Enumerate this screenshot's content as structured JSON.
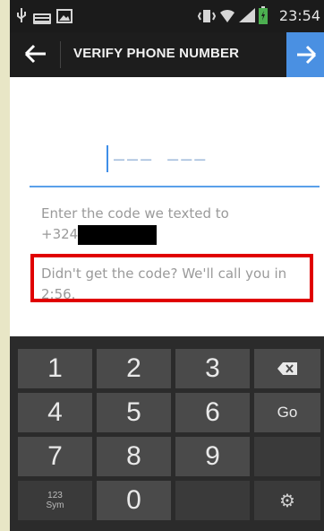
{
  "status_bar": {
    "time": "23:54",
    "icons": [
      "usb-icon",
      "keyboard-icon",
      "image-icon",
      "vibrate-icon",
      "wifi-icon",
      "signal-icon",
      "battery-icon"
    ]
  },
  "action_bar": {
    "title": "VERIFY PHONE NUMBER",
    "back_icon": "back-arrow-icon",
    "next_icon": "forward-arrow-icon",
    "accent": "#4a90e2"
  },
  "code_field": {
    "placeholder": "––– –––"
  },
  "prompt": {
    "line1": "Enter the code we texted to",
    "phone_prefix": "+324"
  },
  "call_notice": {
    "text": "Didn't get the code? We'll call you in 2:56.",
    "highlight_color": "#e00000"
  },
  "keyboard": {
    "keys": [
      "1",
      "2",
      "3",
      "⌫",
      "4",
      "5",
      "6",
      "Go",
      "7",
      "8",
      "9",
      "",
      "123\nSym",
      "0",
      "",
      "⚙"
    ],
    "go_label": "Go",
    "sym_line1": "123",
    "sym_line2": "Sym"
  }
}
